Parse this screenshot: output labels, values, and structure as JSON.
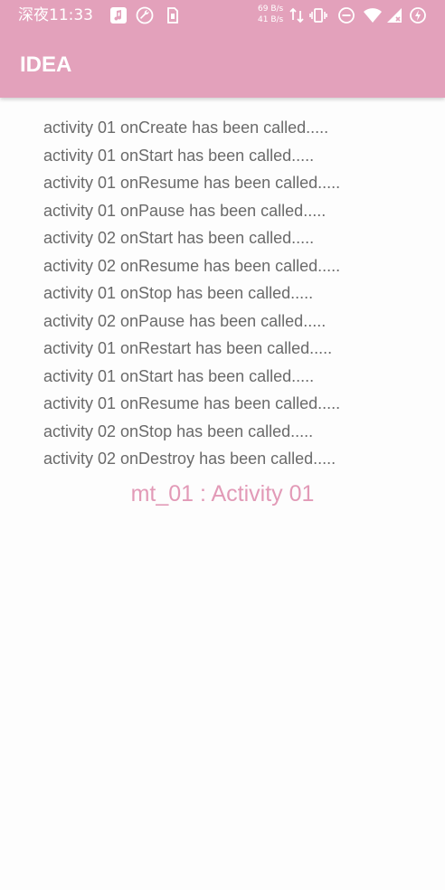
{
  "status_bar": {
    "time": "深夜11:33",
    "net_up": "69 B/s",
    "net_down": "41 B/s"
  },
  "app_bar": {
    "title": "IDEA"
  },
  "log": [
    "activity 01 onCreate has been called.....",
    "activity 01 onStart has been called.....",
    "activity 01 onResume has been called.....",
    "activity 01 onPause has been called.....",
    "activity 02 onStart has been called.....",
    "activity 02 onResume has been called.....",
    "activity 01 onStop has been called.....",
    "activity 02 onPause has been called.....",
    "activity 01 onRestart has been called.....",
    "activity 01 onStart has been called.....",
    "activity 01 onResume has been called.....",
    "activity 02 onStop has been called.....",
    "activity 02 onDestroy has been called....."
  ],
  "footer": {
    "label": "mt_01 : Activity 01"
  },
  "colors": {
    "accent": "#e3a1bb",
    "footer_text": "#e29ab7",
    "log_text": "#6a6a6a"
  },
  "icons": {
    "status_left": [
      "music-note-icon",
      "wrench-icon",
      "sim-card-icon"
    ],
    "status_right": [
      "data-transfer-icon",
      "vibrate-icon",
      "do-not-disturb-icon",
      "wifi-icon",
      "cellular-signal-icon",
      "battery-saver-icon"
    ]
  }
}
